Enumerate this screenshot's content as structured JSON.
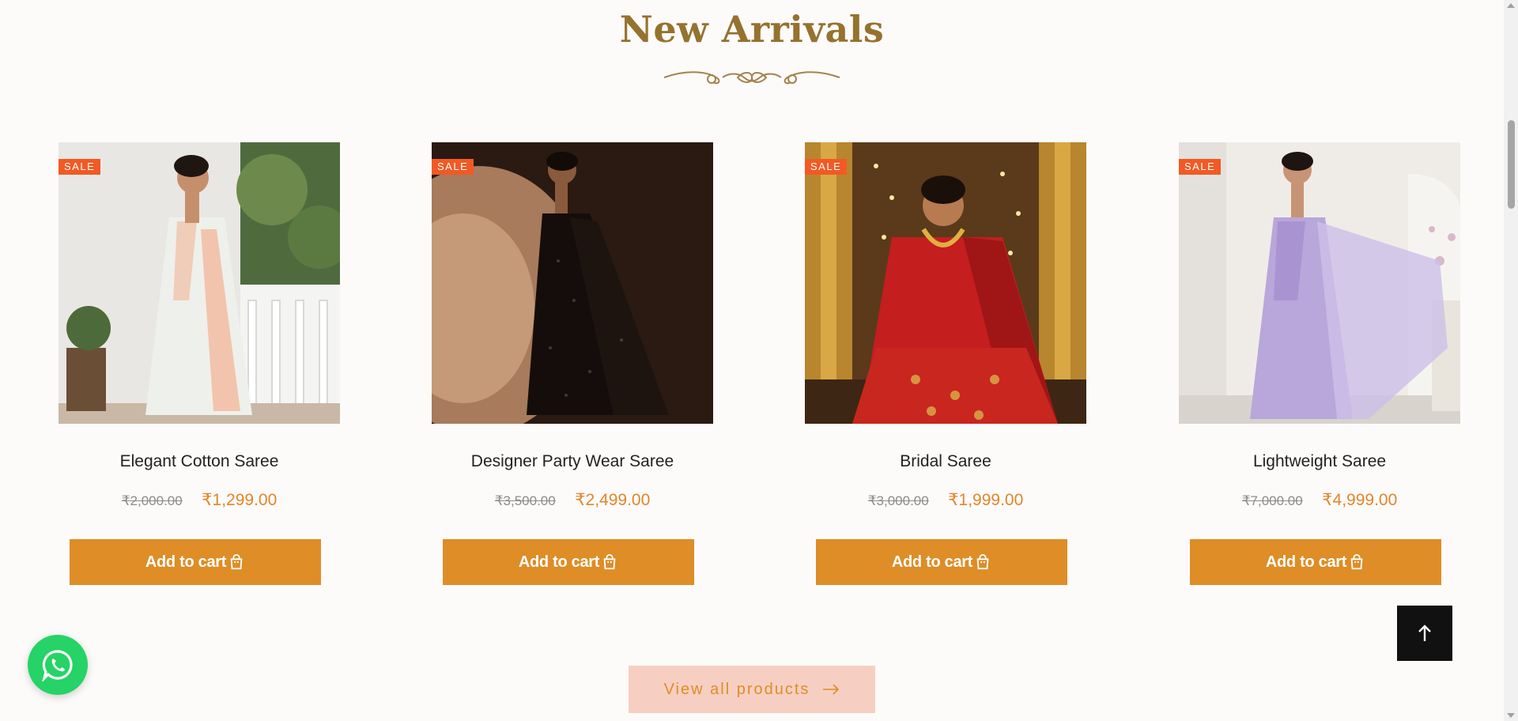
{
  "section": {
    "title": "New Arrivals"
  },
  "products": [
    {
      "name": "Elegant Cotton Saree",
      "badge": "SALE",
      "old_price": "₹2,000.00",
      "price": "₹1,299.00",
      "button": "Add to cart"
    },
    {
      "name": "Designer Party Wear Saree",
      "badge": "SALE",
      "old_price": "₹3,500.00",
      "price": "₹2,499.00",
      "button": "Add to cart"
    },
    {
      "name": "Bridal Saree",
      "badge": "SALE",
      "old_price": "₹3,000.00",
      "price": "₹1,999.00",
      "button": "Add to cart"
    },
    {
      "name": "Lightweight Saree",
      "badge": "SALE",
      "old_price": "₹7,000.00",
      "price": "₹4,999.00",
      "button": "Add to cart"
    }
  ],
  "view_all": {
    "label": "View all products"
  },
  "icons": {
    "divider": "ornamental-divider-icon",
    "cart": "shopping-bag-icon",
    "arrow": "arrow-right-icon",
    "back_to_top": "arrow-up-icon",
    "chat": "whatsapp-icon"
  },
  "colors": {
    "title": "#95722e",
    "accent": "#de8d27",
    "sale_badge": "#f15a24",
    "view_all_bg": "#f7cfc2",
    "whatsapp": "#25d366"
  }
}
